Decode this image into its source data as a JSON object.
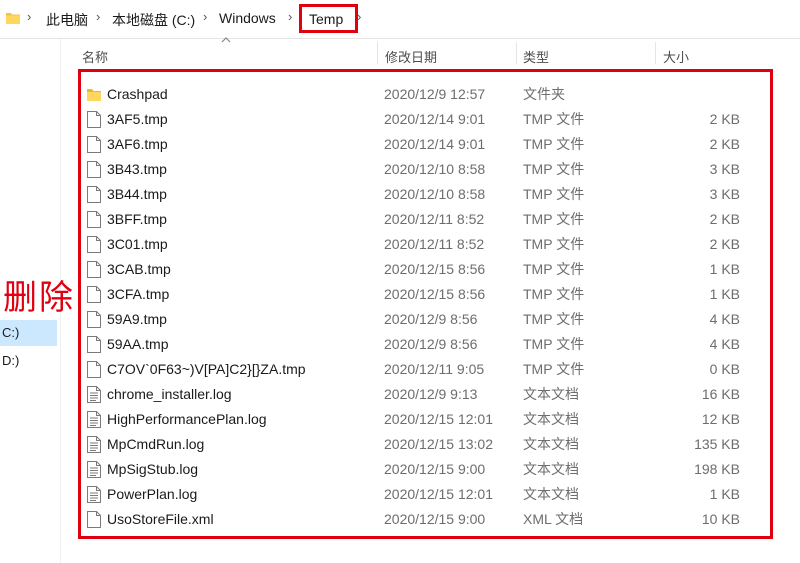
{
  "breadcrumb": {
    "items": [
      "此电脑",
      "本地磁盘 (C:)",
      "Windows",
      "Temp"
    ],
    "separator": "›"
  },
  "nav": {
    "items": [
      {
        "label": "C:)",
        "selected": true
      },
      {
        "label": "D:)",
        "selected": false
      }
    ]
  },
  "annotation": {
    "delete_label": "删除",
    "highlight_color": "#e10010"
  },
  "columns": {
    "name": "名称",
    "date": "修改日期",
    "type": "类型",
    "size": "大小"
  },
  "files": [
    {
      "name": "Crashpad",
      "date": "2020/12/9 12:57",
      "type": "文件夹",
      "size": "",
      "icon": "folder-icon"
    },
    {
      "name": "3AF5.tmp",
      "date": "2020/12/14 9:01",
      "type": "TMP 文件",
      "size": "2 KB",
      "icon": "file-icon"
    },
    {
      "name": "3AF6.tmp",
      "date": "2020/12/14 9:01",
      "type": "TMP 文件",
      "size": "2 KB",
      "icon": "file-icon"
    },
    {
      "name": "3B43.tmp",
      "date": "2020/12/10 8:58",
      "type": "TMP 文件",
      "size": "3 KB",
      "icon": "file-icon"
    },
    {
      "name": "3B44.tmp",
      "date": "2020/12/10 8:58",
      "type": "TMP 文件",
      "size": "3 KB",
      "icon": "file-icon"
    },
    {
      "name": "3BFF.tmp",
      "date": "2020/12/11 8:52",
      "type": "TMP 文件",
      "size": "2 KB",
      "icon": "file-icon"
    },
    {
      "name": "3C01.tmp",
      "date": "2020/12/11 8:52",
      "type": "TMP 文件",
      "size": "2 KB",
      "icon": "file-icon"
    },
    {
      "name": "3CAB.tmp",
      "date": "2020/12/15 8:56",
      "type": "TMP 文件",
      "size": "1 KB",
      "icon": "file-icon"
    },
    {
      "name": "3CFA.tmp",
      "date": "2020/12/15 8:56",
      "type": "TMP 文件",
      "size": "1 KB",
      "icon": "file-icon"
    },
    {
      "name": "59A9.tmp",
      "date": "2020/12/9 8:56",
      "type": "TMP 文件",
      "size": "4 KB",
      "icon": "file-icon"
    },
    {
      "name": "59AA.tmp",
      "date": "2020/12/9 8:56",
      "type": "TMP 文件",
      "size": "4 KB",
      "icon": "file-icon"
    },
    {
      "name": "C7OV`0F63~)V[PA]C2}[}ZA.tmp",
      "date": "2020/12/11 9:05",
      "type": "TMP 文件",
      "size": "0 KB",
      "icon": "file-icon"
    },
    {
      "name": "chrome_installer.log",
      "date": "2020/12/9 9:13",
      "type": "文本文档",
      "size": "16 KB",
      "icon": "text-file-icon"
    },
    {
      "name": "HighPerformancePlan.log",
      "date": "2020/12/15 12:01",
      "type": "文本文档",
      "size": "12 KB",
      "icon": "text-file-icon"
    },
    {
      "name": "MpCmdRun.log",
      "date": "2020/12/15 13:02",
      "type": "文本文档",
      "size": "135 KB",
      "icon": "text-file-icon"
    },
    {
      "name": "MpSigStub.log",
      "date": "2020/12/15 9:00",
      "type": "文本文档",
      "size": "198 KB",
      "icon": "text-file-icon"
    },
    {
      "name": "PowerPlan.log",
      "date": "2020/12/15 12:01",
      "type": "文本文档",
      "size": "1 KB",
      "icon": "text-file-icon"
    },
    {
      "name": "UsoStoreFile.xml",
      "date": "2020/12/15 9:00",
      "type": "XML 文档",
      "size": "10 KB",
      "icon": "file-icon"
    }
  ]
}
